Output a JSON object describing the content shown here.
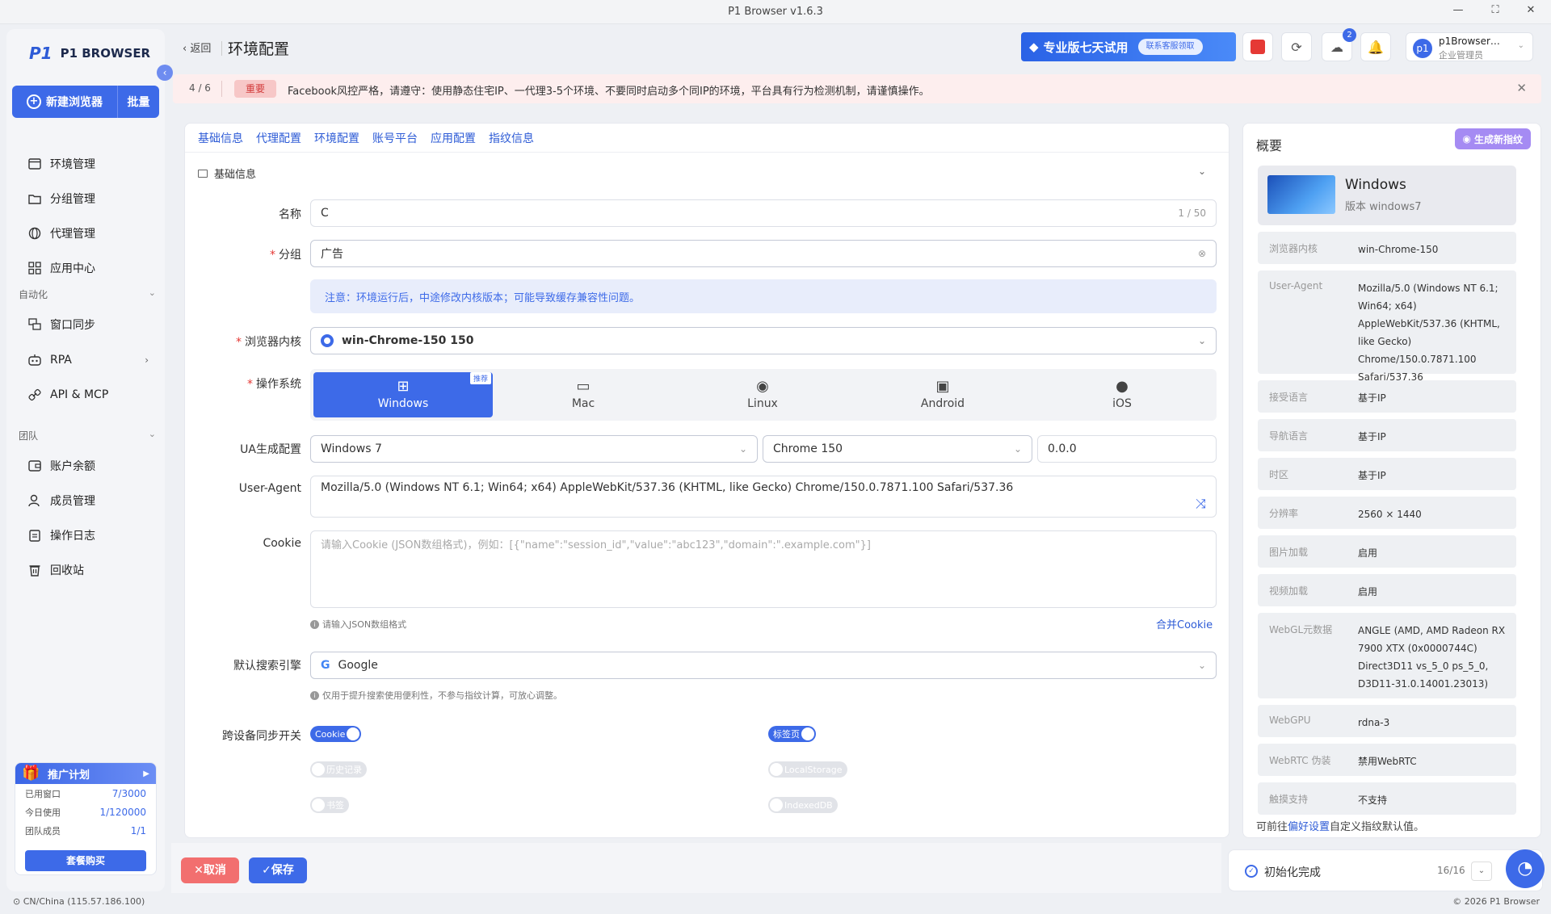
{
  "window": {
    "title": "P1 Browser v1.6.3"
  },
  "sidebar": {
    "logo": "P1 BROWSER",
    "new_browser": "新建浏览器",
    "batch": "批量",
    "items": [
      "环境管理",
      "分组管理",
      "代理管理",
      "应用中心"
    ],
    "section_auto": "自动化",
    "auto_items": [
      "窗口同步",
      "RPA",
      "API & MCP"
    ],
    "section_team": "团队",
    "team_items": [
      "账户余额",
      "成员管理",
      "操作日志",
      "回收站"
    ],
    "promo": {
      "title": "推广计划",
      "rows": [
        [
          "已用窗口",
          "7/3000"
        ],
        [
          "今日使用",
          "1/120000"
        ],
        [
          "团队成员",
          "1/1"
        ]
      ],
      "buy": "套餐购买"
    },
    "geo": "CN/China (115.57.186.100)"
  },
  "header": {
    "back": "返回",
    "title": "环境配置",
    "trial": "专业版七天试用",
    "trial_pill": "联系客服领取",
    "badge": "2",
    "user_name": "p1Browser…",
    "user_role": "企业管理员",
    "avatar": "p1"
  },
  "notice": {
    "count": "4 / 6",
    "tag": "重要",
    "text": "Facebook风控严格，请遵守：使用静态住宅IP、一代理3-5个环境、不要同时启动多个同IP的环境，平台具有行为检测机制，请谨慎操作。"
  },
  "tabs": [
    "基础信息",
    "代理配置",
    "环境配置",
    "账号平台",
    "应用配置",
    "指纹信息"
  ],
  "form": {
    "section": "基础信息",
    "name_label": "名称",
    "name_value": "C",
    "name_count": "1 / 50",
    "group_label": "分组",
    "group_value": "广告",
    "hint": "注意：环境运行后，中途修改内核版本；可能导致缓存兼容性问题。",
    "kernel_label": "浏览器内核",
    "kernel_value": "win-Chrome-150 150",
    "os_label": "操作系统",
    "os": [
      "Windows",
      "Mac",
      "Linux",
      "Android",
      "iOS"
    ],
    "os_badge": "推荐",
    "ua_label": "UA生成配置",
    "ua_os": "Windows 7",
    "ua_browser": "Chrome 150",
    "ua_ver": "0.0.0",
    "useragent_label": "User-Agent",
    "useragent": "Mozilla/5.0 (Windows NT 6.1; Win64; x64) AppleWebKit/537.36 (KHTML, like Gecko) Chrome/150.0.7871.100 Safari/537.36",
    "cookie_label": "Cookie",
    "cookie_placeholder": "请输入Cookie (JSON数组格式)，例如：[{\"name\":\"session_id\",\"value\":\"abc123\",\"domain\":\".example.com\"}]",
    "cookie_hint": "请输入JSON数组格式",
    "merge_cookie": "合并Cookie",
    "search_label": "默认搜索引擎",
    "search_value": "Google",
    "search_hint": "仅用于提升搜索使用便利性，不参与指纹计算，可放心调整。",
    "sync_label": "跨设备同步开关",
    "sync": [
      "Cookie",
      "标签页",
      "历史记录",
      "LocalStorage",
      "书签",
      "IndexedDB"
    ]
  },
  "footer": {
    "cancel": "取消",
    "save": "保存"
  },
  "summary": {
    "title": "概要",
    "gen": "生成新指纹",
    "os_name": "Windows",
    "os_ver": "版本 windows7",
    "rows": [
      [
        "浏览器内核",
        "win-Chrome-150"
      ],
      [
        "User-Agent",
        "Mozilla/5.0 (Windows NT 6.1; Win64; x64) AppleWebKit/537.36 (KHTML, like Gecko) Chrome/150.0.7871.100 Safari/537.36"
      ],
      [
        "接受语言",
        "基于IP"
      ],
      [
        "导航语言",
        "基于IP"
      ],
      [
        "时区",
        "基于IP"
      ],
      [
        "分辨率",
        "2560 × 1440"
      ],
      [
        "图片加载",
        "启用"
      ],
      [
        "视频加载",
        "启用"
      ],
      [
        "WebGL元数据",
        "ANGLE (AMD, AMD Radeon RX 7900 XTX (0x0000744C) Direct3D11 vs_5_0 ps_5_0, D3D11-31.0.14001.23013)"
      ],
      [
        "WebGPU",
        "rdna-3"
      ],
      [
        "WebRTC 伪装",
        "禁用WebRTC"
      ],
      [
        "触摸支持",
        "不支持"
      ]
    ],
    "foot_pre": "可前往",
    "foot_link": "偏好设置",
    "foot_post": "自定义指纹默认值。"
  },
  "init": {
    "text": "初始化完成",
    "count": "16/16"
  },
  "copyright": "© 2026 P1 Browser"
}
